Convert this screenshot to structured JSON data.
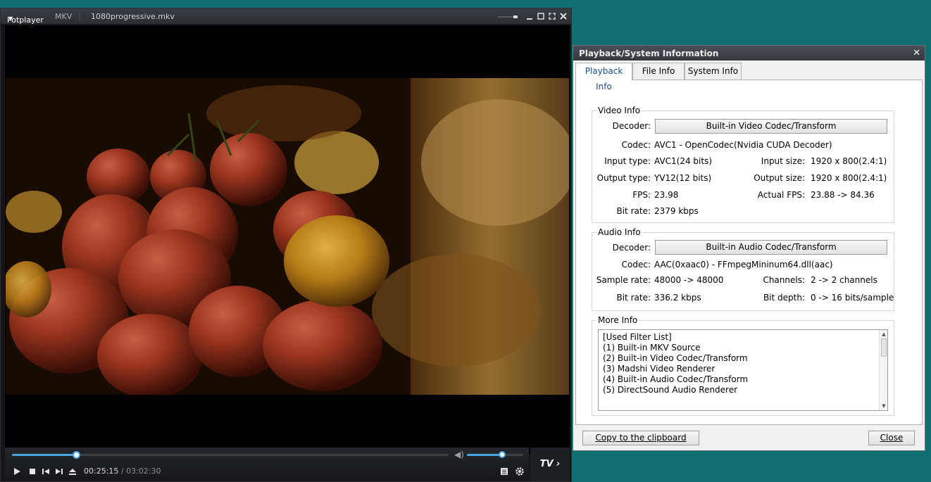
{
  "player": {
    "brand": "Potplayer",
    "format": "MKV",
    "filename": "1080progressive.mkv",
    "seek_progress": 0.146,
    "volume_level": 0.63,
    "time_current": "00:25:15",
    "time_separator": " / ",
    "time_total": "03:02:30",
    "tv_label": "TV"
  },
  "dialog": {
    "title": "Playback/System Information",
    "tabs": [
      "Playback Info",
      "File Info",
      "System Info"
    ],
    "active_tab": "Playback Info",
    "video": {
      "title": "Video Info",
      "decoder_label": "Decoder:",
      "decoder": "Built-in Video Codec/Transform",
      "codec_label": "Codec:",
      "codec": "AVC1 - OpenCodec(Nvidia CUDA Decoder)",
      "input_type_label": "Input type:",
      "input_type": "AVC1(24 bits)",
      "input_size_label": "Input size:",
      "input_size": "1920 x 800(2.4:1)",
      "output_type_label": "Output type:",
      "output_type": "YV12(12 bits)",
      "output_size_label": "Output size:",
      "output_size": "1920 x 800(2.4:1)",
      "fps_label": "FPS:",
      "fps": "23.98",
      "actual_fps_label": "Actual FPS:",
      "actual_fps": "23.88 -> 84.36",
      "bitrate_label": "Bit rate:",
      "bitrate": "2379 kbps"
    },
    "audio": {
      "title": "Audio Info",
      "decoder_label": "Decoder:",
      "decoder": "Built-in Audio Codec/Transform",
      "codec_label": "Codec:",
      "codec": "AAC(0xaac0) - FFmpegMininum64.dll(aac)",
      "sample_rate_label": "Sample rate:",
      "sample_rate": "48000 -> 48000",
      "channels_label": "Channels:",
      "channels": "2 -> 2 channels",
      "bitrate_label": "Bit rate:",
      "bitrate": "336.2 kbps",
      "bit_depth_label": "Bit depth:",
      "bit_depth": "0 -> 16 bits/sample"
    },
    "more": {
      "title": "More Info",
      "lines": [
        "[Used Filter List]",
        "(1) Built-in MKV Source",
        "(2) Built-in Video Codec/Transform",
        "(3) Madshi Video Renderer",
        "(4) Built-in Audio Codec/Transform",
        "(5) DirectSound Audio Renderer"
      ]
    },
    "copy_button": "Copy to the clipboard",
    "close_button": "Close"
  }
}
